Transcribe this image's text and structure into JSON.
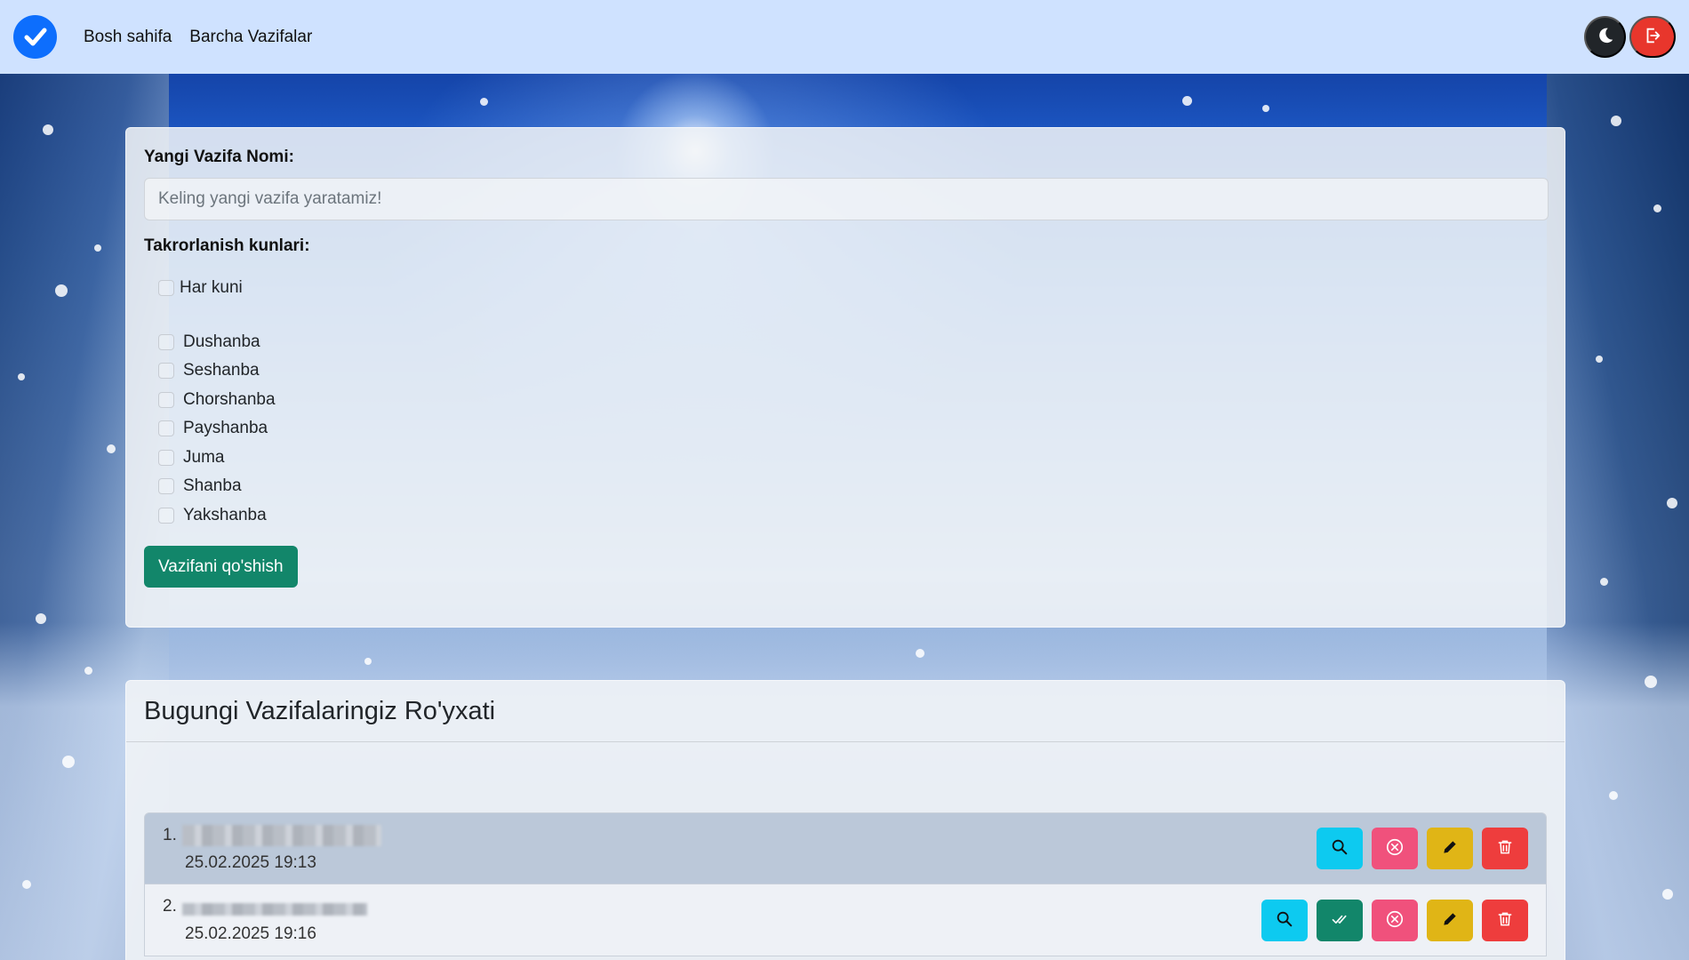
{
  "nav": {
    "links": [
      "Bosh sahifa",
      "Barcha Vazifalar"
    ]
  },
  "form": {
    "name_label": "Yangi Vazifa Nomi:",
    "name_placeholder": "Keling yangi vazifa yaratamiz!",
    "name_value": "",
    "repeat_label": "Takrorlanish kunlari:",
    "everyday_label": "Har kuni",
    "days": [
      "Dushanba",
      "Seshanba",
      "Chorshanba",
      "Payshanba",
      "Juma",
      "Shanba",
      "Yakshanba"
    ],
    "submit_label": "Vazifani qo'shish"
  },
  "list": {
    "title": "Bugungi Vazifalaringiz Ro'yxati",
    "tasks": [
      {
        "number": "1.",
        "date": "25.02.2025 19:13"
      },
      {
        "number": "2.",
        "date": "25.02.2025 19:16"
      }
    ]
  },
  "colors": {
    "navbar": "#cfe2ff",
    "primary": "#0d6efd",
    "success": "#12866a",
    "info": "#0dcaf0",
    "pink": "#f0517c",
    "warning": "#e0b516",
    "danger": "#ee3d3d"
  },
  "icons": {
    "logo": "check-circle-icon",
    "theme": "moon-icon",
    "logout": "logout-icon",
    "view": "search-icon",
    "done": "double-check-icon",
    "cancel": "x-circle-icon",
    "edit": "pencil-icon",
    "delete": "trash-icon"
  }
}
